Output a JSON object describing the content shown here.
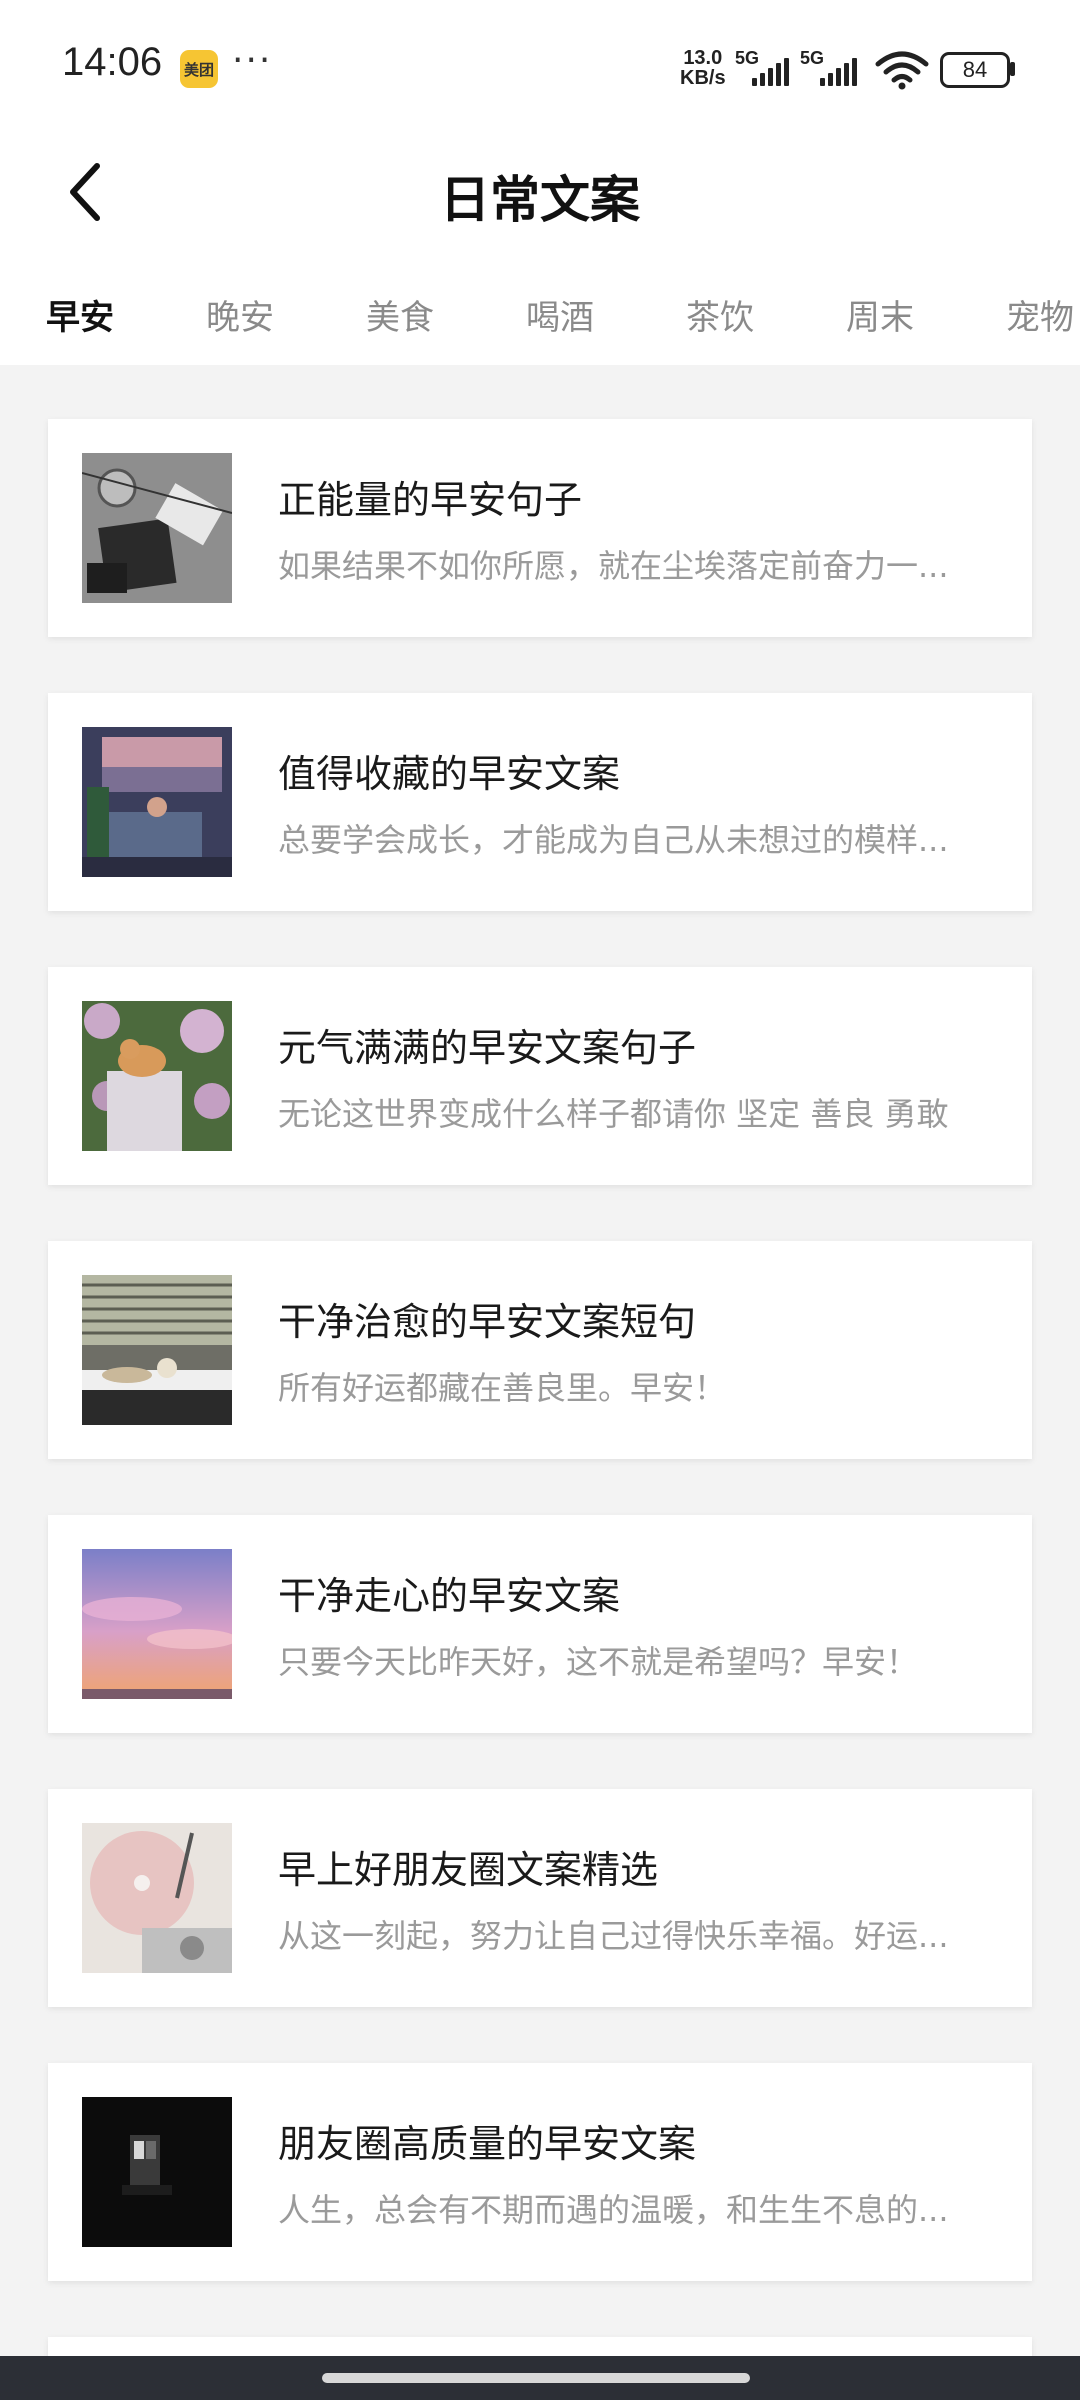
{
  "status_bar": {
    "time": "14:06",
    "app_badge": "美团",
    "more": "···",
    "net_speed_top": "13.0",
    "net_speed_bottom": "KB/s",
    "sim1": "5G",
    "sim2": "5G",
    "battery": "84",
    "icons": [
      "signal-icon",
      "wifi-icon",
      "battery-icon"
    ]
  },
  "header": {
    "title": "日常文案",
    "back_icon": "chevron-left-icon"
  },
  "tabs": [
    {
      "label": "早安",
      "active": true
    },
    {
      "label": "晚安",
      "active": false
    },
    {
      "label": "美食",
      "active": false
    },
    {
      "label": "喝酒",
      "active": false
    },
    {
      "label": "茶饮",
      "active": false
    },
    {
      "label": "周末",
      "active": false
    },
    {
      "label": "宠物",
      "active": false
    }
  ],
  "cards": [
    {
      "title": "正能量的早安句子",
      "desc": "如果结果不如你所愿，就在尘埃落定前奋力一..."
    },
    {
      "title": "值得收藏的早安文案",
      "desc": "总要学会成长，才能成为自己从未想过的模样..."
    },
    {
      "title": "元气满满的早安文案句子",
      "desc": " 无论这世界变成什么样子都请你 坚定 善良 勇敢"
    },
    {
      "title": "干净治愈的早安文案短句",
      "desc": "所有好运都藏在善良里。早安！"
    },
    {
      "title": "干净走心的早安文案",
      "desc": "只要今天比昨天好，这不就是希望吗？早安！"
    },
    {
      "title": "早上好朋友圈文案精选",
      "desc": "从这一刻起，努力让自己过得快乐幸福。好运..."
    },
    {
      "title": "朋友圈高质量的早安文案",
      "desc": "人生，总会有不期而遇的温暖，和生生不息的..."
    }
  ],
  "colors": {
    "background": "#f3f3f3",
    "active_tab": "#111111",
    "inactive_tab": "#8a8a8a",
    "desc_text": "#9a9a9a",
    "nav_bar": "#2c2f36"
  }
}
